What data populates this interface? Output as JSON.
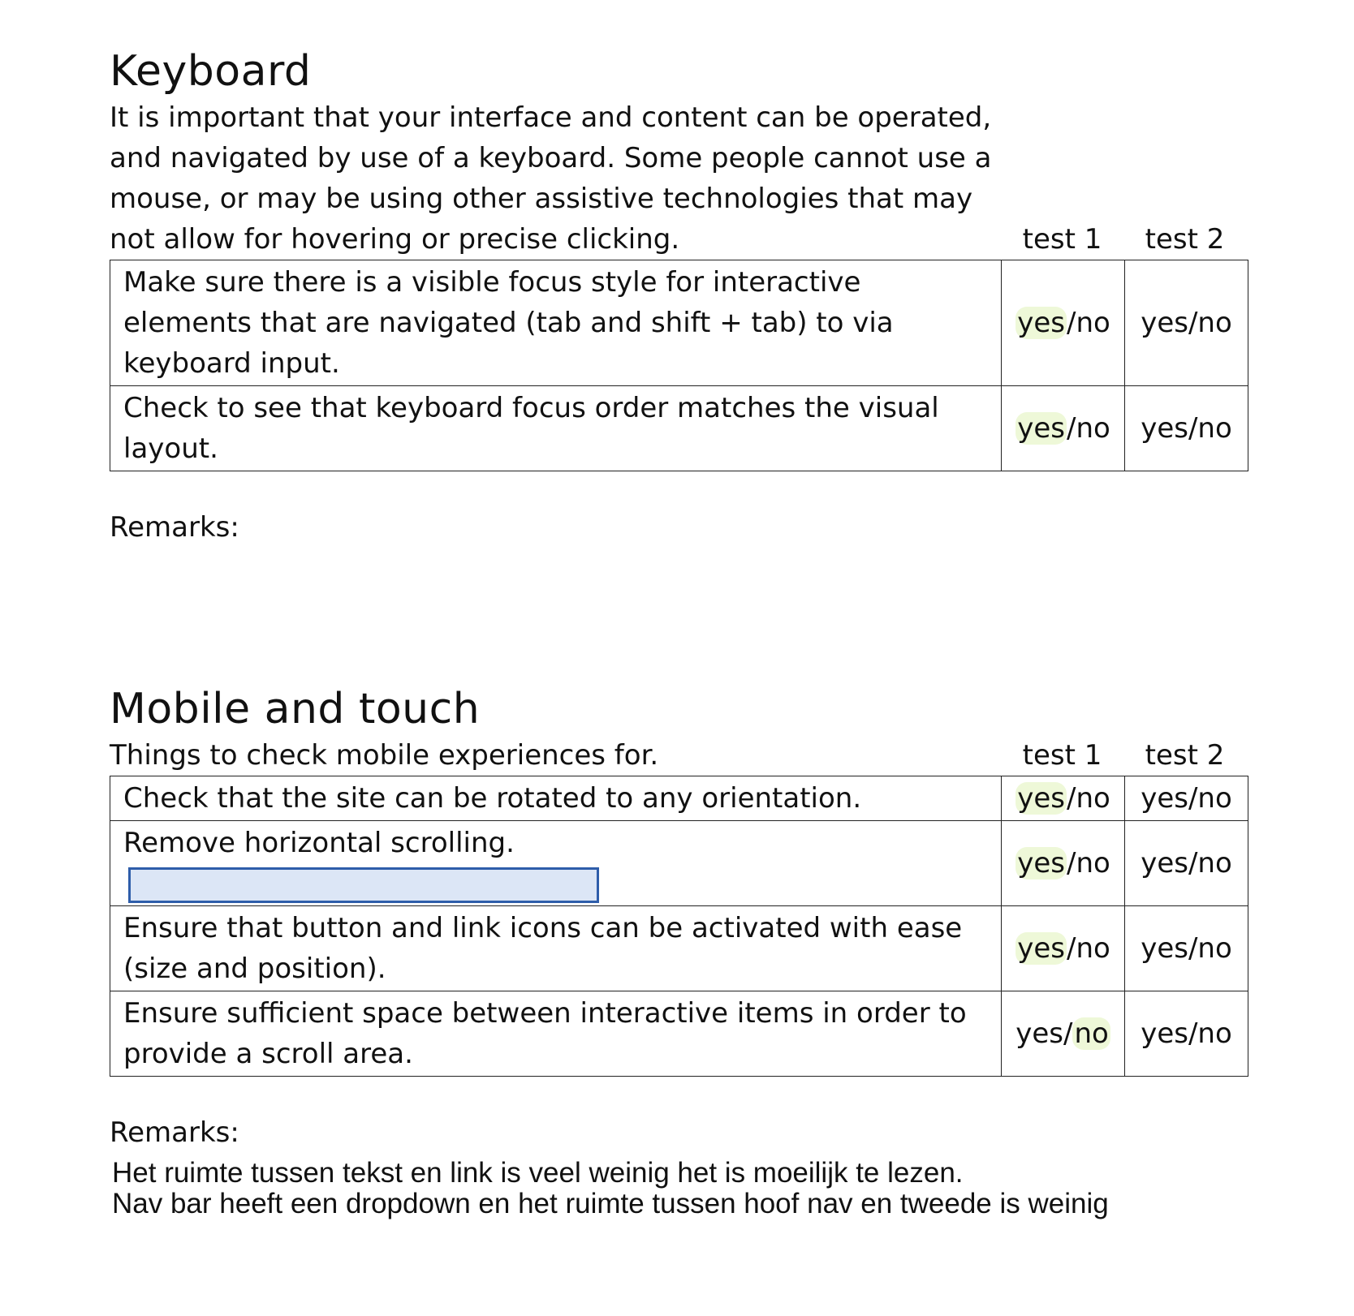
{
  "keyboard": {
    "title": "Keyboard",
    "intro": "It is important that your interface and content can be operated, and navigated by use of a keyboard. Some people cannot use a mouse, or may be using other assistive technologies that may not allow for hovering or precise clicking.",
    "test1_header": "test 1",
    "test2_header": "test 2",
    "rows": [
      {
        "text": "Make sure there is a visible focus style for interactive elements that are navigated (tab and shift + tab) to via keyboard input.",
        "test1": {
          "yes": "yes",
          "sep": "/",
          "no": "no",
          "selected": "yes"
        },
        "test2": "yes/no"
      },
      {
        "text": "Check to see that keyboard focus order matches the visual layout.",
        "test1": {
          "yes": "yes",
          "sep": "/",
          "no": "no",
          "selected": "yes"
        },
        "test2": "yes/no"
      }
    ],
    "remarks_label": "Remarks:"
  },
  "mobile": {
    "title": "Mobile and touch",
    "intro": "Things to check mobile experiences for.",
    "test1_header": "test 1",
    "test2_header": "test 2",
    "rows": [
      {
        "text": "Check that the site can be rotated to any orientation.",
        "test1": {
          "yes": "yes",
          "sep": "/",
          "no": "no",
          "selected": "yes"
        },
        "test2": "yes/no"
      },
      {
        "text": "Remove horizontal scrolling.",
        "test1": {
          "yes": "yes",
          "sep": "/",
          "no": "no",
          "selected": "yes"
        },
        "test2": "yes/no"
      },
      {
        "text": "Ensure that button and link icons can be activated with ease (size and position).",
        "test1": {
          "yes": "yes",
          "sep": "/",
          "no": "no",
          "selected": "yes"
        },
        "test2": "yes/no"
      },
      {
        "text": "Ensure sufficient space between interactive items in order to provide a scroll area.",
        "test1": {
          "yes": "yes",
          "sep": "/",
          "no": "no",
          "selected": "no"
        },
        "test2": "yes/no"
      }
    ],
    "remarks_label": "Remarks:",
    "remarks_lines": [
      "Het ruimte tussen tekst en link is veel weinig het is moeilijk te lezen.",
      "Nav bar heeft een dropdown en het ruimte tussen hoof nav en tweede is weinig"
    ]
  },
  "colors": {
    "highlight": "#eef8d8",
    "focus_fill": "#dce6f6",
    "focus_border": "#2e5daa"
  }
}
